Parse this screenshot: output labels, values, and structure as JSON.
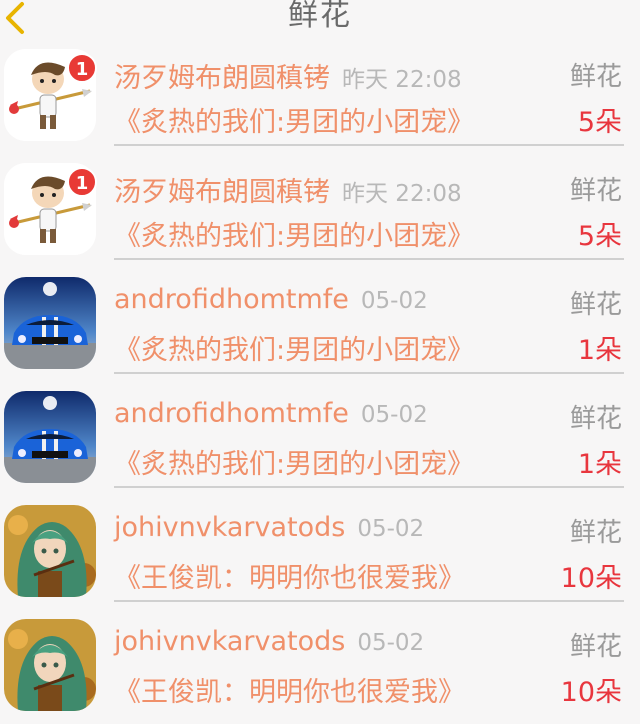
{
  "header": {
    "title": "鲜花",
    "back_icon": "chevron-left-icon"
  },
  "colors": {
    "name": "#f0906a",
    "count": "#e8363e",
    "badge": "#e83a35"
  },
  "rows": [
    {
      "avatar": "cartoon-cupid",
      "badge": "1",
      "name": "汤歹姆布朗圆稹铐",
      "time": "昨天 22:08",
      "type": "鲜花",
      "work": "《炙热的我们:男团的小团宠》",
      "count": "5朵"
    },
    {
      "avatar": "cartoon-cupid",
      "badge": "1",
      "name": "汤歹姆布朗圆稹铐",
      "time": "昨天 22:08",
      "type": "鲜花",
      "work": "《炙热的我们:男团的小团宠》",
      "count": "5朵"
    },
    {
      "avatar": "blue-car",
      "badge": "",
      "name": "androfidhomtmfe",
      "time": "05-02",
      "type": "鲜花",
      "work": "《炙热的我们:男团的小团宠》",
      "count": "1朵"
    },
    {
      "avatar": "blue-car",
      "badge": "",
      "name": "androfidhomtmfe",
      "time": "05-02",
      "type": "鲜花",
      "work": "《炙热的我们:男团的小团宠》",
      "count": "1朵"
    },
    {
      "avatar": "anime-girl",
      "badge": "",
      "name": "johivnvkarvatods",
      "time": "05-02",
      "type": "鲜花",
      "work": "《王俊凯：明明你也很爱我》",
      "count": "10朵"
    },
    {
      "avatar": "anime-girl",
      "badge": "",
      "name": "johivnvkarvatods",
      "time": "05-02",
      "type": "鲜花",
      "work": "《王俊凯：明明你也很爱我》",
      "count": "10朵"
    }
  ]
}
